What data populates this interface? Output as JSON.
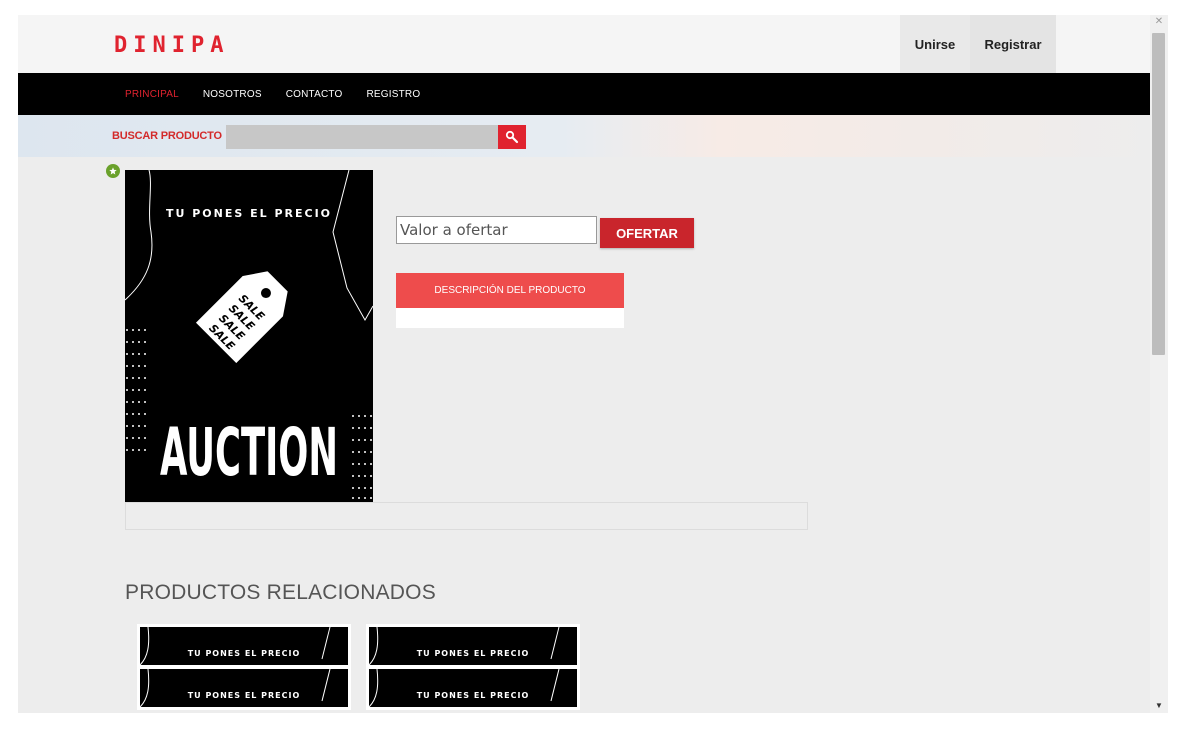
{
  "brand": {
    "logo": "DINIPA",
    "color": "#e0232f"
  },
  "auth": {
    "join_label": "Unirse",
    "register_label": "Registrar"
  },
  "nav": {
    "items": [
      "PRINCIPAL",
      "NOSOTROS",
      "CONTACTO",
      "REGISTRO"
    ],
    "active": "PRINCIPAL"
  },
  "search": {
    "label": "BUSCAR PRODUCTO",
    "placeholder": "",
    "button_icon": "search-icon"
  },
  "product": {
    "image_tagline": "TU PONES EL PRECIO",
    "image_headline": "AUCTION",
    "tag_words": [
      "SALE",
      "SALE",
      "SALE",
      "SALE"
    ],
    "offer_placeholder": "Valor a ofertar",
    "offer_button": "OFERTAR",
    "description_tab": "DESCRIPCIÓN DEL PRODUCTO",
    "badge_icon": "star-icon"
  },
  "related": {
    "title": "PRODUCTOS RELACIONADOS",
    "items": [
      "TU PONES EL PRECIO",
      "TU PONES EL PRECIO",
      "TU PONES EL PRECIO",
      "TU PONES EL PRECIO"
    ]
  },
  "colors": {
    "accent": "#e0232f",
    "button": "#c9252c",
    "tab": "#ee4c4c",
    "nav_bg": "#000000"
  }
}
